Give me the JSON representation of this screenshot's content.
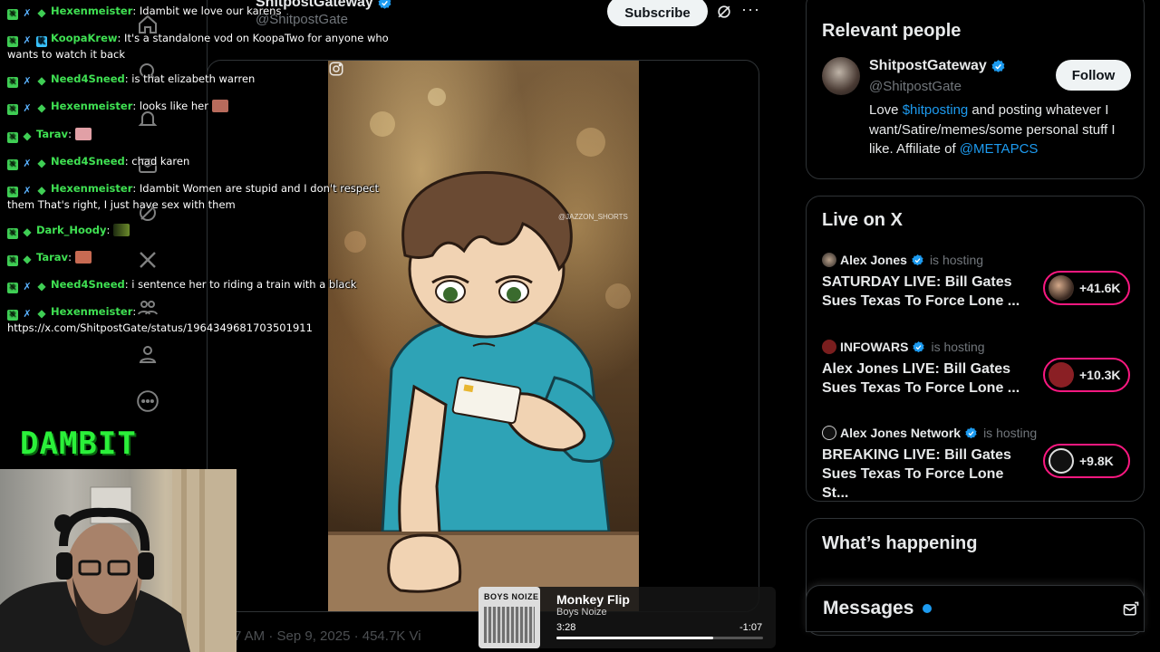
{
  "colors": {
    "accent": "#1d9bf0",
    "live_ring": "#f91880",
    "chat_name": "#3fe052",
    "background": "#000000"
  },
  "post": {
    "author_name": "ShitpostGateway",
    "author_handle": "@ShitpostGate",
    "subscribe_label": "Subscribe",
    "video_watermark": "@JAZZON_SHORTS",
    "date_partial": "7 AM · Sep 9, 2025 · 454.7K Vi"
  },
  "nav": {
    "icons": [
      "home-icon",
      "search-icon",
      "notifications-icon",
      "messages-icon",
      "grok-icon",
      "x-logo-icon",
      "communities-icon",
      "profile-icon",
      "more-icon"
    ]
  },
  "chat": {
    "messages": [
      {
        "user": "Hexenmeister",
        "text": "Idambit we love our karens"
      },
      {
        "user": "KoopaKrew",
        "text": "It's a standalone vod on KoopaTwo for anyone who wants to watch it back"
      },
      {
        "user": "Need4Sneed",
        "text": "is that elizabeth warren"
      },
      {
        "user": "Hexenmeister",
        "text": "looks like her"
      },
      {
        "user": "Tarav",
        "text": ""
      },
      {
        "user": "Need4Sneed",
        "text": "chad karen"
      },
      {
        "user": "Hexenmeister",
        "text": "Idambit Women are stupid and I don't respect them That's right, I just have sex with them"
      },
      {
        "user": "Dark_Hoody",
        "text": ""
      },
      {
        "user": "Tarav",
        "text": ""
      },
      {
        "user": "Need4Sneed",
        "text": "i sentence her to riding a train with a black"
      },
      {
        "user": "Hexenmeister",
        "text": "https://x.com/ShitpostGate/status/1964349681703501911"
      }
    ],
    "overlay_logo": "DAMBIT"
  },
  "relevant_people": {
    "title": "Relevant people",
    "name": "ShitpostGateway",
    "handle": "@ShitpostGate",
    "follow_label": "Follow",
    "bio_1": "Love ",
    "bio_link_1": "$hitposting",
    "bio_2": " and posting whatever I want/Satire/memes/some personal stuff I like. Affiliate of ",
    "bio_link_2": "@METAPCS"
  },
  "live_on_x": {
    "title": "Live on X",
    "hosting_label": "is hosting",
    "items": [
      {
        "host": "Alex Jones",
        "title": "SATURDAY LIVE: Bill Gates Sues Texas To Force Lone ...",
        "count": "+41.6K"
      },
      {
        "host": "INFOWARS",
        "title": "Alex Jones LIVE: Bill Gates Sues Texas To Force Lone ...",
        "count": "+10.3K"
      },
      {
        "host": "Alex Jones Network",
        "title": "BREAKING LIVE: Bill Gates Sues Texas To Force Lone St...",
        "count": "+9.8K"
      }
    ]
  },
  "whats_happening": {
    "title": "What’s happening"
  },
  "messages": {
    "title": "Messages"
  },
  "now_playing": {
    "album_text": "BOYS NOIZE",
    "title": "Monkey Flip",
    "artist": "Boys Noize",
    "elapsed": "3:28",
    "remaining": "-1:07",
    "progress": 0.76
  }
}
